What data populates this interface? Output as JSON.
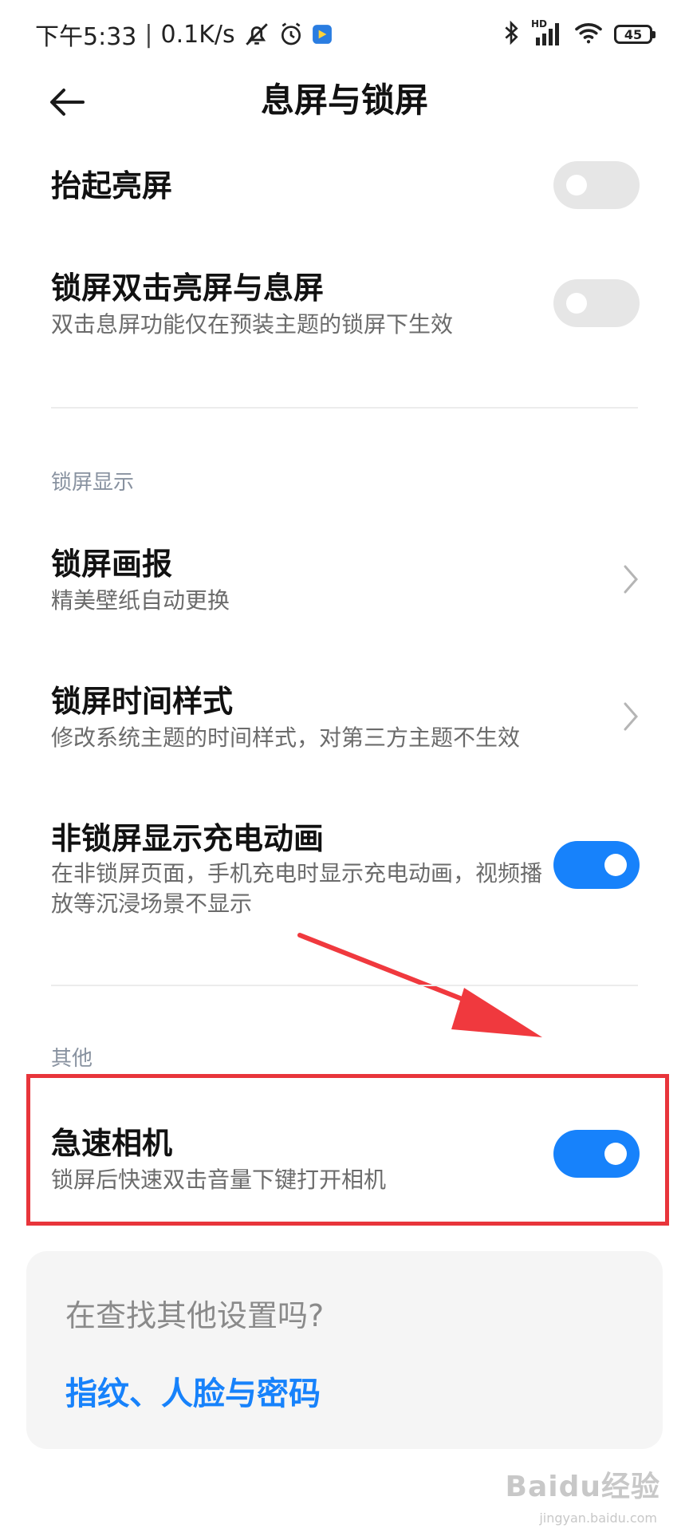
{
  "status_bar": {
    "time": "下午5:33",
    "speed": "0.1K/s",
    "battery": "45",
    "network": "HD"
  },
  "header": {
    "title": "息屏与锁屏",
    "back_icon": "arrow-left-icon"
  },
  "items": [
    {
      "title": "抬起亮屏",
      "subtitle": "",
      "control": "switch",
      "on": false
    },
    {
      "title": "锁屏双击亮屏与息屏",
      "subtitle": "双击息屏功能仅在预装主题的锁屏下生效",
      "control": "switch",
      "on": false
    },
    {
      "title": "锁屏画报",
      "subtitle": "精美壁纸自动更换",
      "control": "chevron"
    },
    {
      "title": "锁屏时间样式",
      "subtitle": "修改系统主题的时间样式，对第三方主题不生效",
      "control": "chevron"
    },
    {
      "title": "非锁屏显示充电动画",
      "subtitle": "在非锁屏页面，手机充电时显示充电动画，视频播放等沉浸场景不显示",
      "control": "switch",
      "on": true
    },
    {
      "title": "急速相机",
      "subtitle": "锁屏后快速双击音量下键打开相机",
      "control": "switch",
      "on": true
    }
  ],
  "sections": {
    "lock_display": "锁屏显示",
    "other": "其他"
  },
  "card": {
    "prompt": "在查找其他设置吗?",
    "link": "指纹、人脸与密码"
  },
  "watermark": {
    "text": "Baidu经验",
    "sub": "jingyan.baidu.com"
  },
  "colors": {
    "accent": "#1782fb",
    "highlight": "#e8353b",
    "switch_off": "#e6e6e6"
  }
}
